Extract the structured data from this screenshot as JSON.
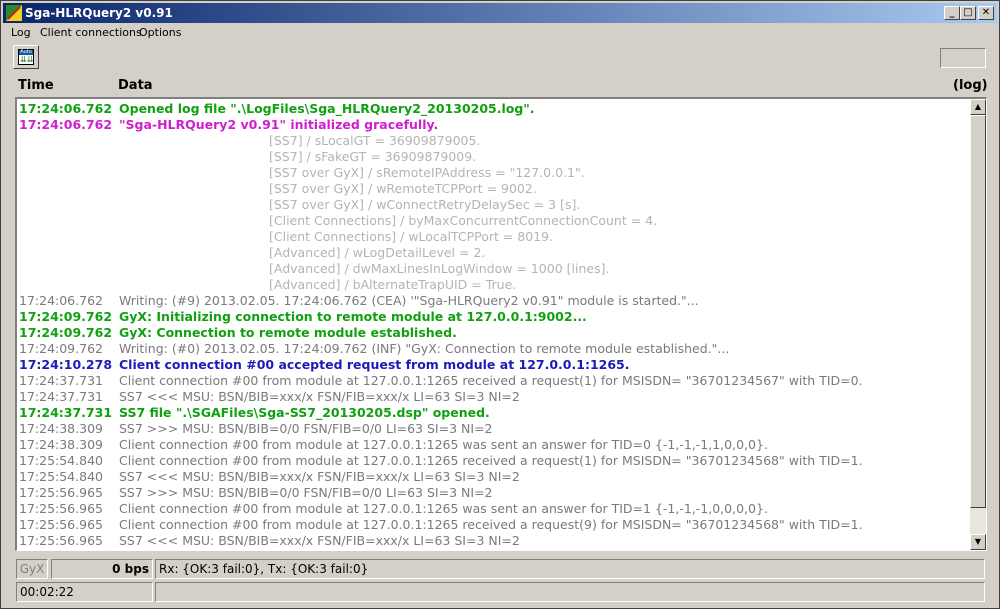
{
  "window": {
    "title": "Sga-HLRQuery2  v0.91"
  },
  "titlebar_buttons": {
    "minimize": "_",
    "maximize": "□",
    "close": "✕"
  },
  "menu": {
    "log": "Log",
    "client_connections": "Client connections",
    "options": "Options"
  },
  "toolbar": {
    "auto_label": "Auto",
    "auto_arrows": "⇊⇊"
  },
  "header": {
    "time": "Time",
    "data": "Data",
    "log": "(log)"
  },
  "scrollbar": {
    "up": "▲",
    "down": "▼"
  },
  "log_rows": [
    {
      "time": "17:24:06.762",
      "text": "Opened log file \".\\LogFiles\\Sga_HLRQuery2_20130205.log\".",
      "style": "green"
    },
    {
      "time": "17:24:06.762",
      "text": "\"Sga-HLRQuery2  v0.91\" initialized gracefully.",
      "style": "magenta"
    },
    {
      "time": "",
      "text": "[SS7] / sLocalGT = 36909879005.",
      "style": "lgray"
    },
    {
      "time": "",
      "text": "[SS7] / sFakeGT = 36909879009.",
      "style": "lgray"
    },
    {
      "time": "",
      "text": "[SS7 over GyX] / sRemoteIPAddress = \"127.0.0.1\".",
      "style": "lgray"
    },
    {
      "time": "",
      "text": "[SS7 over GyX] / wRemoteTCPPort = 9002.",
      "style": "lgray"
    },
    {
      "time": "",
      "text": "[SS7 over GyX] / wConnectRetryDelaySec = 3 [s].",
      "style": "lgray"
    },
    {
      "time": "",
      "text": "[Client Connections] / byMaxConcurrentConnectionCount = 4.",
      "style": "lgray"
    },
    {
      "time": "",
      "text": "[Client Connections] / wLocalTCPPort = 8019.",
      "style": "lgray"
    },
    {
      "time": "",
      "text": "[Advanced] / wLogDetailLevel = 2.",
      "style": "lgray"
    },
    {
      "time": "",
      "text": "[Advanced] / dwMaxLinesInLogWindow = 1000 [lines].",
      "style": "lgray"
    },
    {
      "time": "",
      "text": "[Advanced] / bAlternateTrapUID = True.",
      "style": "lgray"
    },
    {
      "time": "17:24:06.762",
      "text": "Writing: (#9) 2013.02.05. 17:24:06.762 (CEA) '\"Sga-HLRQuery2  v0.91\" module is started.\"...",
      "style": "gray"
    },
    {
      "time": "17:24:09.762",
      "text": "GyX: Initializing connection to remote module at 127.0.0.1:9002...",
      "style": "green"
    },
    {
      "time": "17:24:09.762",
      "text": "GyX: Connection to remote module established.",
      "style": "green"
    },
    {
      "time": "17:24:09.762",
      "text": "Writing: (#0) 2013.02.05. 17:24:09.762 (INF) \"GyX: Connection to remote module established.\"...",
      "style": "gray"
    },
    {
      "time": "17:24:10.278",
      "text": "Client connection #00 accepted request from module at 127.0.0.1:1265.",
      "style": "blue"
    },
    {
      "time": "17:24:37.731",
      "text": "Client connection #00 from module at 127.0.0.1:1265 received a request(1) for MSISDN= \"36701234567\" with TID=0.",
      "style": "gray"
    },
    {
      "time": "17:24:37.731",
      "text": "SS7 <<< MSU: BSN/BIB=xxx/x FSN/FIB=xxx/x LI=63 SI=3 NI=2",
      "style": "gray"
    },
    {
      "time": "17:24:37.731",
      "text": "SS7 file \".\\SGAFiles\\Sga-SS7_20130205.dsp\" opened.",
      "style": "green"
    },
    {
      "time": "17:24:38.309",
      "text": "SS7 >>> MSU: BSN/BIB=0/0 FSN/FIB=0/0 LI=63 SI=3 NI=2",
      "style": "gray"
    },
    {
      "time": "17:24:38.309",
      "text": "Client connection #00 from module at 127.0.0.1:1265 was sent an answer for TID=0 {-1,-1,-1,1,0,0,0}.",
      "style": "gray"
    },
    {
      "time": "17:25:54.840",
      "text": "Client connection #00 from module at 127.0.0.1:1265 received a request(1) for MSISDN= \"36701234568\" with TID=1.",
      "style": "gray"
    },
    {
      "time": "17:25:54.840",
      "text": "SS7 <<< MSU: BSN/BIB=xxx/x FSN/FIB=xxx/x LI=63 SI=3 NI=2",
      "style": "gray"
    },
    {
      "time": "17:25:56.965",
      "text": "SS7 >>> MSU: BSN/BIB=0/0 FSN/FIB=0/0 LI=63 SI=3 NI=2",
      "style": "gray"
    },
    {
      "time": "17:25:56.965",
      "text": "Client connection #00 from module at 127.0.0.1:1265 was sent an answer for TID=1 {-1,-1,-1,0,0,0,0}.",
      "style": "gray"
    },
    {
      "time": "17:25:56.965",
      "text": "Client connection #00 from module at 127.0.0.1:1265 received a request(9) for MSISDN= \"36701234568\" with TID=1.",
      "style": "gray"
    },
    {
      "time": "17:25:56.965",
      "text": "SS7 <<< MSU: BSN/BIB=xxx/x FSN/FIB=xxx/x LI=63 SI=3 NI=2",
      "style": "gray"
    }
  ],
  "statusbar": {
    "gyx_label": "GyX",
    "bps": "0 bps",
    "rxtx": "Rx: {OK:3  fail:0},  Tx: {OK:3  fail:0}",
    "elapsed": "00:02:22"
  },
  "colors": {
    "green": "#11a011",
    "magenta": "#d01ed0",
    "blue": "#1c1cb8",
    "gray": "#7a7a7a",
    "lgray": "#b4b4b4",
    "title_bar": "#0a246a"
  }
}
